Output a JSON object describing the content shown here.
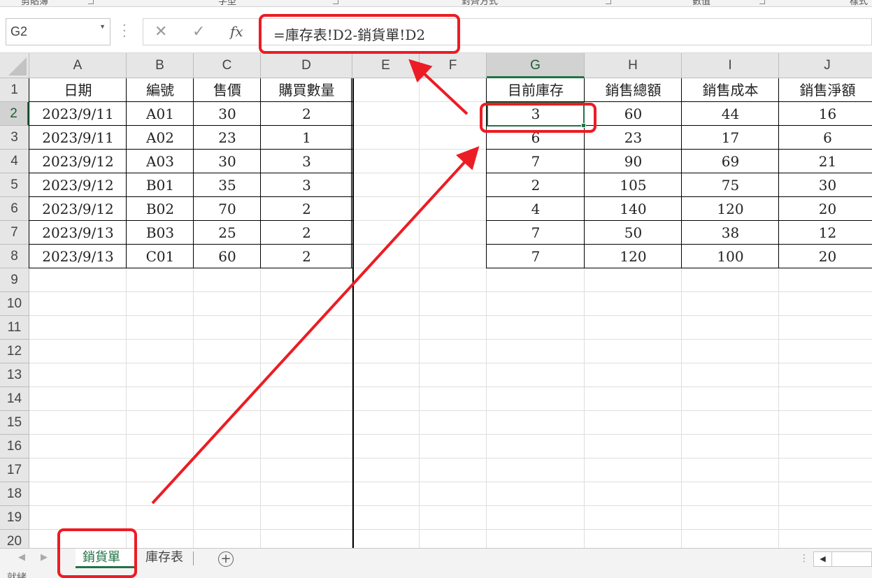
{
  "ribbon": {
    "groups": [
      "剪貼簿",
      "字型",
      "對齊方式",
      "數值",
      "樣式"
    ]
  },
  "formula_bar": {
    "name_box": "G2",
    "cancel_icon": "✕",
    "enter_icon": "✓",
    "fx_label": "fx",
    "formula": "=庫存表!D2-銷貨單!D2"
  },
  "columns": [
    "A",
    "B",
    "C",
    "D",
    "E",
    "F",
    "G",
    "H",
    "I",
    "J"
  ],
  "rows": [
    "1",
    "2",
    "3",
    "4",
    "5",
    "6",
    "7",
    "8",
    "9",
    "10",
    "11",
    "12",
    "13",
    "14",
    "15",
    "16",
    "17",
    "18",
    "19",
    "20"
  ],
  "left_table": {
    "headers": [
      "日期",
      "編號",
      "售價",
      "購買數量"
    ],
    "rows": [
      [
        "2023/9/11",
        "A01",
        "30",
        "2"
      ],
      [
        "2023/9/11",
        "A02",
        "23",
        "1"
      ],
      [
        "2023/9/12",
        "A03",
        "30",
        "3"
      ],
      [
        "2023/9/12",
        "B01",
        "35",
        "3"
      ],
      [
        "2023/9/12",
        "B02",
        "70",
        "2"
      ],
      [
        "2023/9/13",
        "B03",
        "25",
        "2"
      ],
      [
        "2023/9/13",
        "C01",
        "60",
        "2"
      ]
    ]
  },
  "right_table": {
    "headers": [
      "目前庫存",
      "銷售總額",
      "銷售成本",
      "銷售淨額"
    ],
    "rows": [
      [
        "3",
        "60",
        "44",
        "16"
      ],
      [
        "6",
        "23",
        "17",
        "6"
      ],
      [
        "7",
        "90",
        "69",
        "21"
      ],
      [
        "2",
        "105",
        "75",
        "30"
      ],
      [
        "4",
        "140",
        "120",
        "20"
      ],
      [
        "7",
        "50",
        "38",
        "12"
      ],
      [
        "7",
        "120",
        "100",
        "20"
      ]
    ]
  },
  "sheet_tabs": {
    "active": "銷貨單",
    "other": "庫存表",
    "add_icon": "+"
  },
  "status": {
    "text": "就緒"
  },
  "colors": {
    "accent": "#217346",
    "annotation": "#ec1c24"
  }
}
